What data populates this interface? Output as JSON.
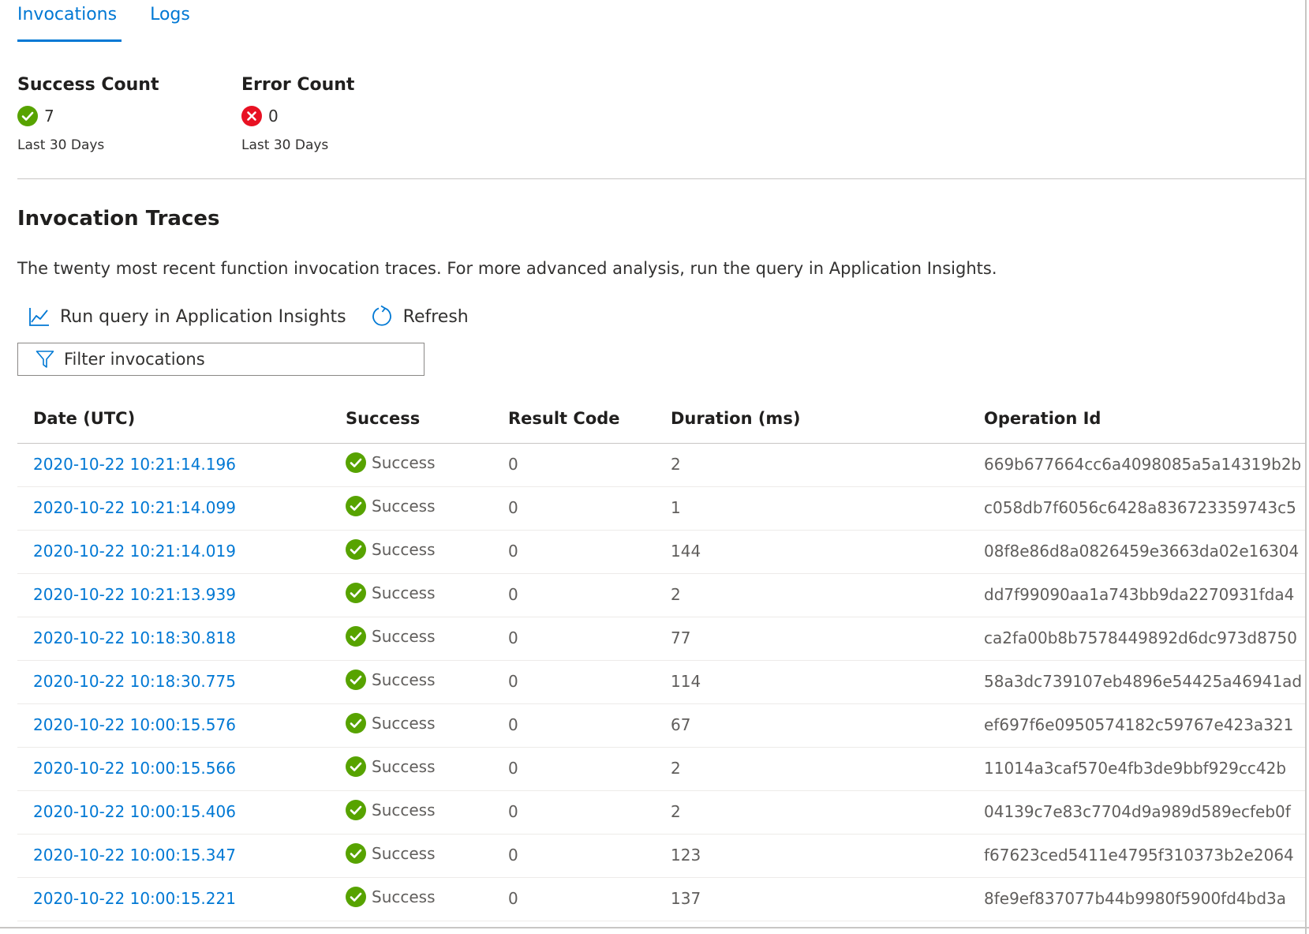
{
  "tabs": [
    {
      "label": "Invocations",
      "active": true
    },
    {
      "label": "Logs",
      "active": false
    }
  ],
  "stats": {
    "success": {
      "title": "Success Count",
      "value": "7",
      "period": "Last 30 Days",
      "icon": "check-circle-icon",
      "color": "#57a300"
    },
    "error": {
      "title": "Error Count",
      "value": "0",
      "period": "Last 30 Days",
      "icon": "error-circle-icon",
      "color": "#e81123"
    }
  },
  "section": {
    "title": "Invocation Traces",
    "description": "The twenty most recent function invocation traces. For more advanced analysis, run the query in Application Insights."
  },
  "toolbar": {
    "run_query_label": "Run query in Application Insights",
    "refresh_label": "Refresh"
  },
  "filter": {
    "placeholder": "Filter invocations",
    "value": ""
  },
  "table": {
    "columns": [
      "Date (UTC)",
      "Success",
      "Result Code",
      "Duration (ms)",
      "Operation Id"
    ],
    "rows": [
      {
        "date": "2020-10-22 10:21:14.196",
        "success": "Success",
        "code": "0",
        "duration": "2",
        "op": "669b677664cc6a4098085a5a14319b2b"
      },
      {
        "date": "2020-10-22 10:21:14.099",
        "success": "Success",
        "code": "0",
        "duration": "1",
        "op": "c058db7f6056c6428a836723359743c5"
      },
      {
        "date": "2020-10-22 10:21:14.019",
        "success": "Success",
        "code": "0",
        "duration": "144",
        "op": "08f8e86d8a0826459e3663da02e16304"
      },
      {
        "date": "2020-10-22 10:21:13.939",
        "success": "Success",
        "code": "0",
        "duration": "2",
        "op": "dd7f99090aa1a743bb9da2270931fda4"
      },
      {
        "date": "2020-10-22 10:18:30.818",
        "success": "Success",
        "code": "0",
        "duration": "77",
        "op": "ca2fa00b8b7578449892d6dc973d8750"
      },
      {
        "date": "2020-10-22 10:18:30.775",
        "success": "Success",
        "code": "0",
        "duration": "114",
        "op": "58a3dc739107eb4896e54425a46941ad"
      },
      {
        "date": "2020-10-22 10:00:15.576",
        "success": "Success",
        "code": "0",
        "duration": "67",
        "op": "ef697f6e0950574182c59767e423a321"
      },
      {
        "date": "2020-10-22 10:00:15.566",
        "success": "Success",
        "code": "0",
        "duration": "2",
        "op": "11014a3caf570e4fb3de9bbf929cc42b"
      },
      {
        "date": "2020-10-22 10:00:15.406",
        "success": "Success",
        "code": "0",
        "duration": "2",
        "op": "04139c7e83c7704d9a989d589ecfeb0f"
      },
      {
        "date": "2020-10-22 10:00:15.347",
        "success": "Success",
        "code": "0",
        "duration": "123",
        "op": "f67623ced5411e4795f310373b2e2064"
      },
      {
        "date": "2020-10-22 10:00:15.221",
        "success": "Success",
        "code": "0",
        "duration": "137",
        "op": "8fe9ef837077b44b9980f5900fd4bd3a"
      }
    ]
  }
}
